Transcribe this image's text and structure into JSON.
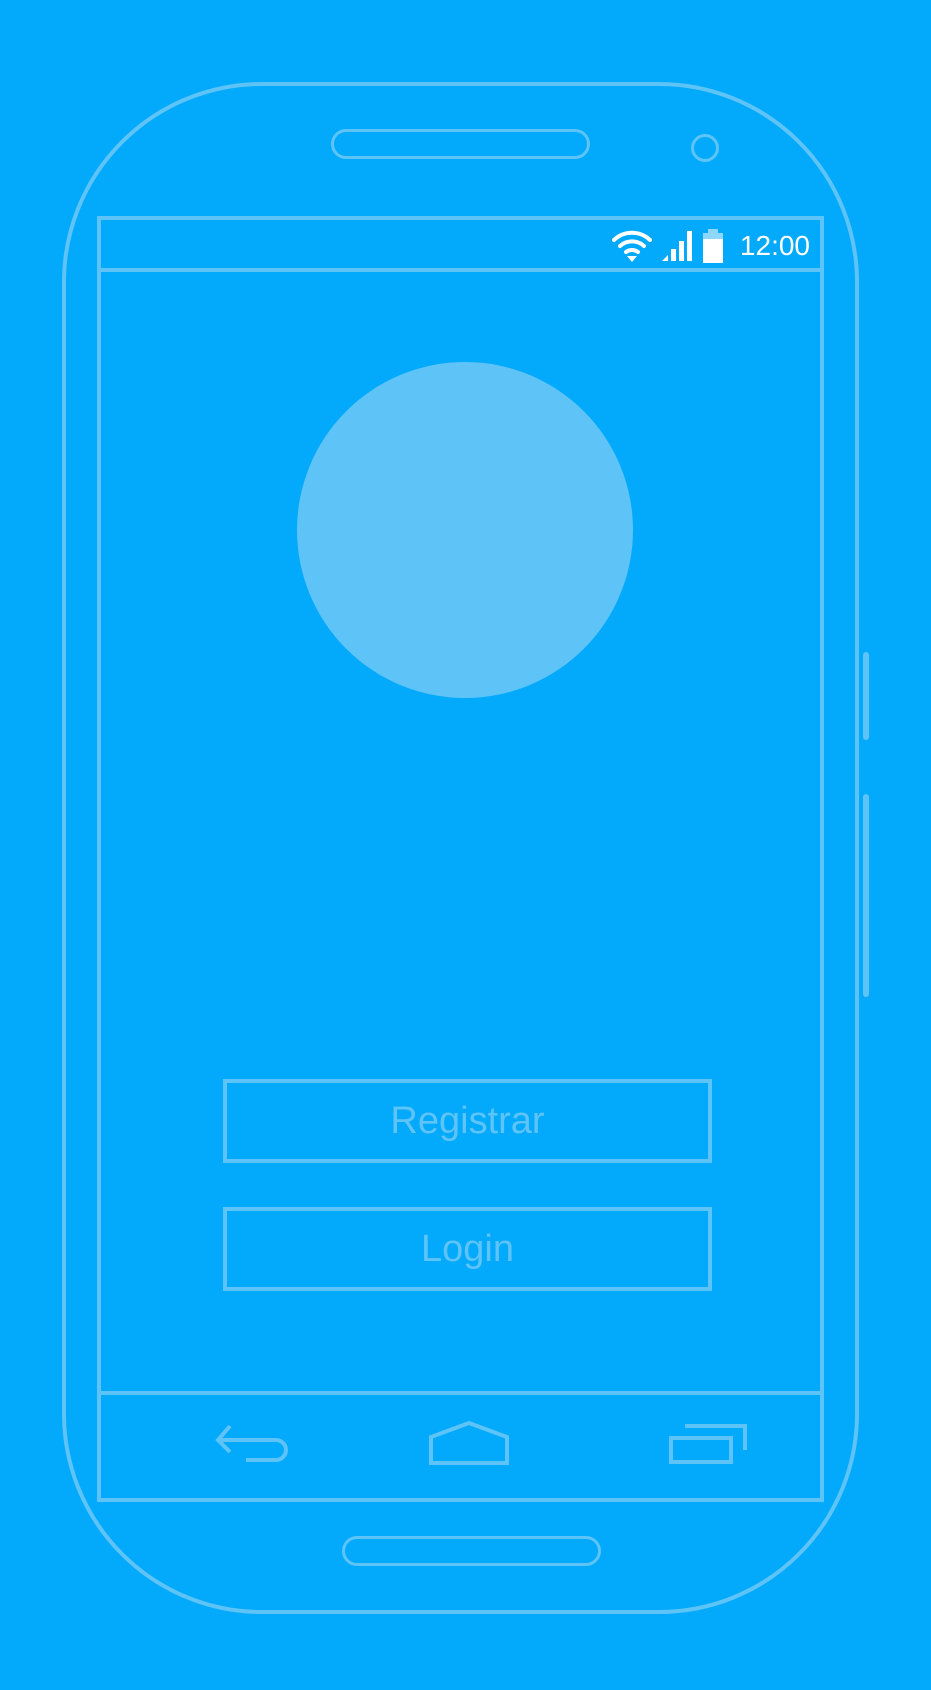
{
  "status_bar": {
    "time": "12:00",
    "icons": [
      "wifi-icon",
      "signal-icon",
      "battery-icon"
    ]
  },
  "main": {
    "logo": "logo-placeholder",
    "register_label": "Registrar",
    "login_label": "Login"
  },
  "nav_bar": {
    "icons": [
      "back-icon",
      "home-icon",
      "recent-apps-icon"
    ]
  },
  "colors": {
    "background": "#03a9fa",
    "outline": "#5ec4f7",
    "status_text": "#ffffff"
  }
}
